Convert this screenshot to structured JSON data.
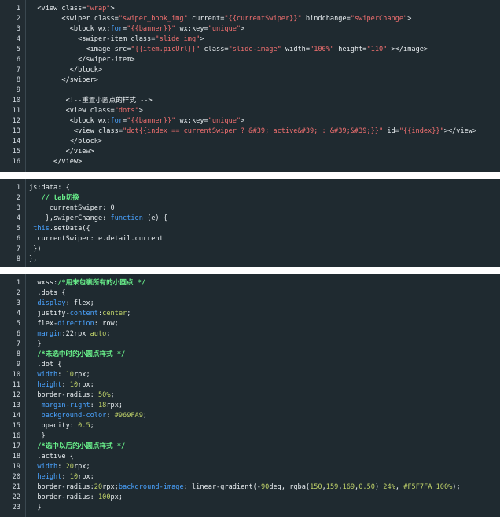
{
  "colors": {
    "background": "#1f2a30",
    "gutter": "#222c32",
    "plain": "#e8edf0",
    "string": "#f27070",
    "keyword": "#4aa3ff",
    "number": "#c2d46a",
    "comment": "#69f08b"
  },
  "blocks": [
    {
      "name": "wxml-block",
      "lines": [
        {
          "n": "1",
          "tokens": [
            {
              "t": "  <view class=",
              "c": "plain"
            },
            {
              "t": "\"wrap\"",
              "c": "str"
            },
            {
              "t": ">",
              "c": "plain"
            }
          ]
        },
        {
          "n": "2",
          "tokens": [
            {
              "t": "        <swiper class=",
              "c": "plain"
            },
            {
              "t": "\"swiper_book_img\"",
              "c": "str"
            },
            {
              "t": " current=",
              "c": "plain"
            },
            {
              "t": "\"{{currentSwiper}}\"",
              "c": "str"
            },
            {
              "t": " bindchange=",
              "c": "plain"
            },
            {
              "t": "\"swiperChange\"",
              "c": "str"
            },
            {
              "t": ">",
              "c": "plain"
            }
          ]
        },
        {
          "n": "3",
          "tokens": [
            {
              "t": "          <block wx:",
              "c": "plain"
            },
            {
              "t": "for",
              "c": "kw"
            },
            {
              "t": "=",
              "c": "plain"
            },
            {
              "t": "\"{{banner}}\"",
              "c": "str"
            },
            {
              "t": " wx:key=",
              "c": "plain"
            },
            {
              "t": "\"unique\"",
              "c": "str"
            },
            {
              "t": ">",
              "c": "plain"
            }
          ]
        },
        {
          "n": "4",
          "tokens": [
            {
              "t": "            <swiper-item class=",
              "c": "plain"
            },
            {
              "t": "\"slide_img\"",
              "c": "str"
            },
            {
              "t": ">",
              "c": "plain"
            }
          ]
        },
        {
          "n": "5",
          "tokens": [
            {
              "t": "              <image src=",
              "c": "plain"
            },
            {
              "t": "\"{{item.picUrl}}\"",
              "c": "str"
            },
            {
              "t": " class=",
              "c": "plain"
            },
            {
              "t": "\"slide-image\"",
              "c": "str"
            },
            {
              "t": " width=",
              "c": "plain"
            },
            {
              "t": "\"100%\"",
              "c": "str"
            },
            {
              "t": " height=",
              "c": "plain"
            },
            {
              "t": "\"110\"",
              "c": "str"
            },
            {
              "t": " ></image>",
              "c": "plain"
            }
          ]
        },
        {
          "n": "6",
          "tokens": [
            {
              "t": "            </swiper-item>",
              "c": "plain"
            }
          ]
        },
        {
          "n": "7",
          "tokens": [
            {
              "t": "          </block>",
              "c": "plain"
            }
          ]
        },
        {
          "n": "8",
          "tokens": [
            {
              "t": "        </swiper>",
              "c": "plain"
            }
          ]
        },
        {
          "n": "9",
          "tokens": []
        },
        {
          "n": "10",
          "tokens": [
            {
              "t": "         <!--重置小圆点的样式 -->",
              "c": "plain"
            }
          ]
        },
        {
          "n": "11",
          "tokens": [
            {
              "t": "         <view class=",
              "c": "plain"
            },
            {
              "t": "\"dots\"",
              "c": "str"
            },
            {
              "t": ">",
              "c": "plain"
            }
          ]
        },
        {
          "n": "12",
          "tokens": [
            {
              "t": "          <block wx:",
              "c": "plain"
            },
            {
              "t": "for",
              "c": "kw"
            },
            {
              "t": "=",
              "c": "plain"
            },
            {
              "t": "\"{{banner}}\"",
              "c": "str"
            },
            {
              "t": " wx:key=",
              "c": "plain"
            },
            {
              "t": "\"unique\"",
              "c": "str"
            },
            {
              "t": ">",
              "c": "plain"
            }
          ]
        },
        {
          "n": "13",
          "tokens": [
            {
              "t": "           <view class=",
              "c": "plain"
            },
            {
              "t": "\"dot{{index == currentSwiper ? &#39; active&#39; : &#39;&#39;}}\"",
              "c": "str"
            },
            {
              "t": " id=",
              "c": "plain"
            },
            {
              "t": "\"{{index}}\"",
              "c": "str"
            },
            {
              "t": "></view>",
              "c": "plain"
            }
          ]
        },
        {
          "n": "14",
          "tokens": [
            {
              "t": "          </block>",
              "c": "plain"
            }
          ]
        },
        {
          "n": "15",
          "tokens": [
            {
              "t": "         </view>",
              "c": "plain"
            }
          ]
        },
        {
          "n": "16",
          "tokens": [
            {
              "t": "      </view>",
              "c": "plain"
            }
          ]
        }
      ]
    },
    {
      "name": "js-block",
      "lines": [
        {
          "n": "1",
          "tokens": [
            {
              "t": "js:data: {",
              "c": "plain"
            }
          ]
        },
        {
          "n": "2",
          "tokens": [
            {
              "t": "   // tab切换",
              "c": "cmt"
            }
          ]
        },
        {
          "n": "3",
          "tokens": [
            {
              "t": "     currentSwiper: 0",
              "c": "plain"
            }
          ]
        },
        {
          "n": "4",
          "tokens": [
            {
              "t": "    },swiperChange: ",
              "c": "plain"
            },
            {
              "t": "function",
              "c": "kw"
            },
            {
              "t": " (e) {",
              "c": "plain"
            }
          ]
        },
        {
          "n": "5",
          "tokens": [
            {
              "t": " ",
              "c": "plain"
            },
            {
              "t": "this",
              "c": "kw"
            },
            {
              "t": ".setData({",
              "c": "plain"
            }
          ]
        },
        {
          "n": "6",
          "tokens": [
            {
              "t": "  currentSwiper: e.detail.current",
              "c": "plain"
            }
          ]
        },
        {
          "n": "7",
          "tokens": [
            {
              "t": " })",
              "c": "plain"
            }
          ]
        },
        {
          "n": "8",
          "tokens": [
            {
              "t": "},",
              "c": "plain"
            }
          ]
        }
      ]
    },
    {
      "name": "wxss-block",
      "lines": [
        {
          "n": "1",
          "tokens": [
            {
              "t": "  wxss:",
              "c": "plain"
            },
            {
              "t": "/*用来包裹所有的小圆点 */",
              "c": "cmt"
            }
          ]
        },
        {
          "n": "2",
          "tokens": [
            {
              "t": "  .dots {",
              "c": "plain"
            }
          ]
        },
        {
          "n": "3",
          "tokens": [
            {
              "t": "  ",
              "c": "plain"
            },
            {
              "t": "display",
              "c": "kw"
            },
            {
              "t": ": flex;",
              "c": "plain"
            }
          ]
        },
        {
          "n": "4",
          "tokens": [
            {
              "t": "  justify-",
              "c": "plain"
            },
            {
              "t": "content",
              "c": "kw"
            },
            {
              "t": ":",
              "c": "plain"
            },
            {
              "t": "center",
              "c": "num"
            },
            {
              "t": ";",
              "c": "plain"
            }
          ]
        },
        {
          "n": "5",
          "tokens": [
            {
              "t": "  flex-",
              "c": "plain"
            },
            {
              "t": "direction",
              "c": "kw"
            },
            {
              "t": ": row;",
              "c": "plain"
            }
          ]
        },
        {
          "n": "6",
          "tokens": [
            {
              "t": "  ",
              "c": "plain"
            },
            {
              "t": "margin",
              "c": "kw"
            },
            {
              "t": ":22rpx ",
              "c": "plain"
            },
            {
              "t": "auto",
              "c": "num"
            },
            {
              "t": ";",
              "c": "plain"
            }
          ]
        },
        {
          "n": "7",
          "tokens": [
            {
              "t": "  }",
              "c": "plain"
            }
          ]
        },
        {
          "n": "8",
          "tokens": [
            {
              "t": "  ",
              "c": "plain"
            },
            {
              "t": "/*未选中时的小圆点样式 */",
              "c": "cmt"
            }
          ]
        },
        {
          "n": "9",
          "tokens": [
            {
              "t": "  .dot {",
              "c": "plain"
            }
          ]
        },
        {
          "n": "10",
          "tokens": [
            {
              "t": "  ",
              "c": "plain"
            },
            {
              "t": "width",
              "c": "kw"
            },
            {
              "t": ": ",
              "c": "plain"
            },
            {
              "t": "10",
              "c": "num"
            },
            {
              "t": "rpx;",
              "c": "plain"
            }
          ]
        },
        {
          "n": "11",
          "tokens": [
            {
              "t": "  ",
              "c": "plain"
            },
            {
              "t": "height",
              "c": "kw"
            },
            {
              "t": ": ",
              "c": "plain"
            },
            {
              "t": "10",
              "c": "num"
            },
            {
              "t": "rpx;",
              "c": "plain"
            }
          ]
        },
        {
          "n": "12",
          "tokens": [
            {
              "t": "  border-radius: ",
              "c": "plain"
            },
            {
              "t": "50%",
              "c": "num"
            },
            {
              "t": ";",
              "c": "plain"
            }
          ]
        },
        {
          "n": "13",
          "tokens": [
            {
              "t": "   ",
              "c": "plain"
            },
            {
              "t": "margin-right",
              "c": "kw"
            },
            {
              "t": ": ",
              "c": "plain"
            },
            {
              "t": "18",
              "c": "num"
            },
            {
              "t": "rpx;",
              "c": "plain"
            }
          ]
        },
        {
          "n": "14",
          "tokens": [
            {
              "t": "   ",
              "c": "plain"
            },
            {
              "t": "background-color",
              "c": "kw"
            },
            {
              "t": ": ",
              "c": "plain"
            },
            {
              "t": "#969FA9",
              "c": "num"
            },
            {
              "t": ";",
              "c": "plain"
            }
          ]
        },
        {
          "n": "15",
          "tokens": [
            {
              "t": "   opacity: ",
              "c": "plain"
            },
            {
              "t": "0.5",
              "c": "num"
            },
            {
              "t": ";",
              "c": "plain"
            }
          ]
        },
        {
          "n": "16",
          "tokens": [
            {
              "t": "   }",
              "c": "plain"
            }
          ]
        },
        {
          "n": "17",
          "tokens": [
            {
              "t": "  ",
              "c": "plain"
            },
            {
              "t": "/*选中以后的小圆点样式 */",
              "c": "cmt"
            }
          ]
        },
        {
          "n": "18",
          "tokens": [
            {
              "t": "  .active {",
              "c": "plain"
            }
          ]
        },
        {
          "n": "19",
          "tokens": [
            {
              "t": "  ",
              "c": "plain"
            },
            {
              "t": "width",
              "c": "kw"
            },
            {
              "t": ": ",
              "c": "plain"
            },
            {
              "t": "20",
              "c": "num"
            },
            {
              "t": "rpx;",
              "c": "plain"
            }
          ]
        },
        {
          "n": "20",
          "tokens": [
            {
              "t": "  ",
              "c": "plain"
            },
            {
              "t": "height",
              "c": "kw"
            },
            {
              "t": ": ",
              "c": "plain"
            },
            {
              "t": "10",
              "c": "num"
            },
            {
              "t": "rpx;",
              "c": "plain"
            }
          ]
        },
        {
          "n": "21",
          "tokens": [
            {
              "t": "  border-radius:",
              "c": "plain"
            },
            {
              "t": "20",
              "c": "num"
            },
            {
              "t": "rpx;",
              "c": "plain"
            },
            {
              "t": "background-image",
              "c": "kw"
            },
            {
              "t": ": linear-gradient(-",
              "c": "plain"
            },
            {
              "t": "90",
              "c": "num"
            },
            {
              "t": "deg, rgba(",
              "c": "plain"
            },
            {
              "t": "150",
              "c": "num"
            },
            {
              "t": ",",
              "c": "plain"
            },
            {
              "t": "159",
              "c": "num"
            },
            {
              "t": ",",
              "c": "plain"
            },
            {
              "t": "169",
              "c": "num"
            },
            {
              "t": ",",
              "c": "plain"
            },
            {
              "t": "0.50",
              "c": "num"
            },
            {
              "t": ") ",
              "c": "plain"
            },
            {
              "t": "24%",
              "c": "num"
            },
            {
              "t": ", ",
              "c": "plain"
            },
            {
              "t": "#F5F7FA",
              "c": "num"
            },
            {
              "t": " ",
              "c": "plain"
            },
            {
              "t": "100%",
              "c": "num"
            },
            {
              "t": ");",
              "c": "plain"
            }
          ]
        },
        {
          "n": "22",
          "tokens": [
            {
              "t": "  border-radius: ",
              "c": "plain"
            },
            {
              "t": "100",
              "c": "num"
            },
            {
              "t": "px;",
              "c": "plain"
            }
          ]
        },
        {
          "n": "23",
          "tokens": [
            {
              "t": "  }",
              "c": "plain"
            }
          ]
        }
      ]
    }
  ]
}
